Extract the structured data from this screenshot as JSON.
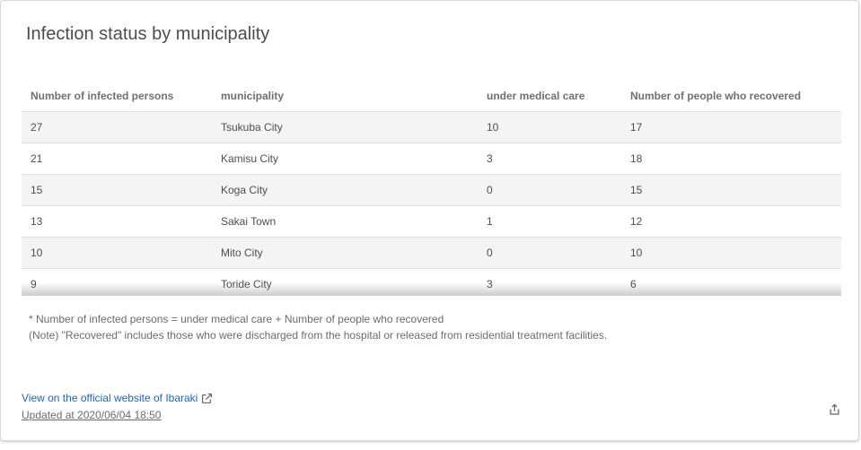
{
  "card": {
    "title": "Infection status by municipality"
  },
  "table": {
    "headers": [
      "Number of infected persons",
      "municipality",
      "under medical care",
      "Number of people who recovered"
    ],
    "rows": [
      [
        "27",
        "Tsukuba City",
        "10",
        "17"
      ],
      [
        "21",
        "Kamisu City",
        "3",
        "18"
      ],
      [
        "15",
        "Koga City",
        "0",
        "15"
      ],
      [
        "13",
        "Sakai Town",
        "1",
        "12"
      ],
      [
        "10",
        "Mito City",
        "0",
        "10"
      ],
      [
        "9",
        "Toride City",
        "3",
        "6"
      ]
    ]
  },
  "notes": {
    "line1": "* Number of infected persons = under medical care + Number of people who recovered",
    "line2": "(Note) \"Recovered\" includes those who were discharged from the hospital or released from residential treatment facilities."
  },
  "footer": {
    "link_label": "View on the official website of Ibaraki",
    "updated": "Updated at 2020/06/04 18:50",
    "link_icon": "external-link-icon",
    "share_icon": "share-icon"
  },
  "colors": {
    "link": "#1d66b8",
    "title": "#4d4d4d",
    "row_stripe": "#f4f4f4"
  }
}
